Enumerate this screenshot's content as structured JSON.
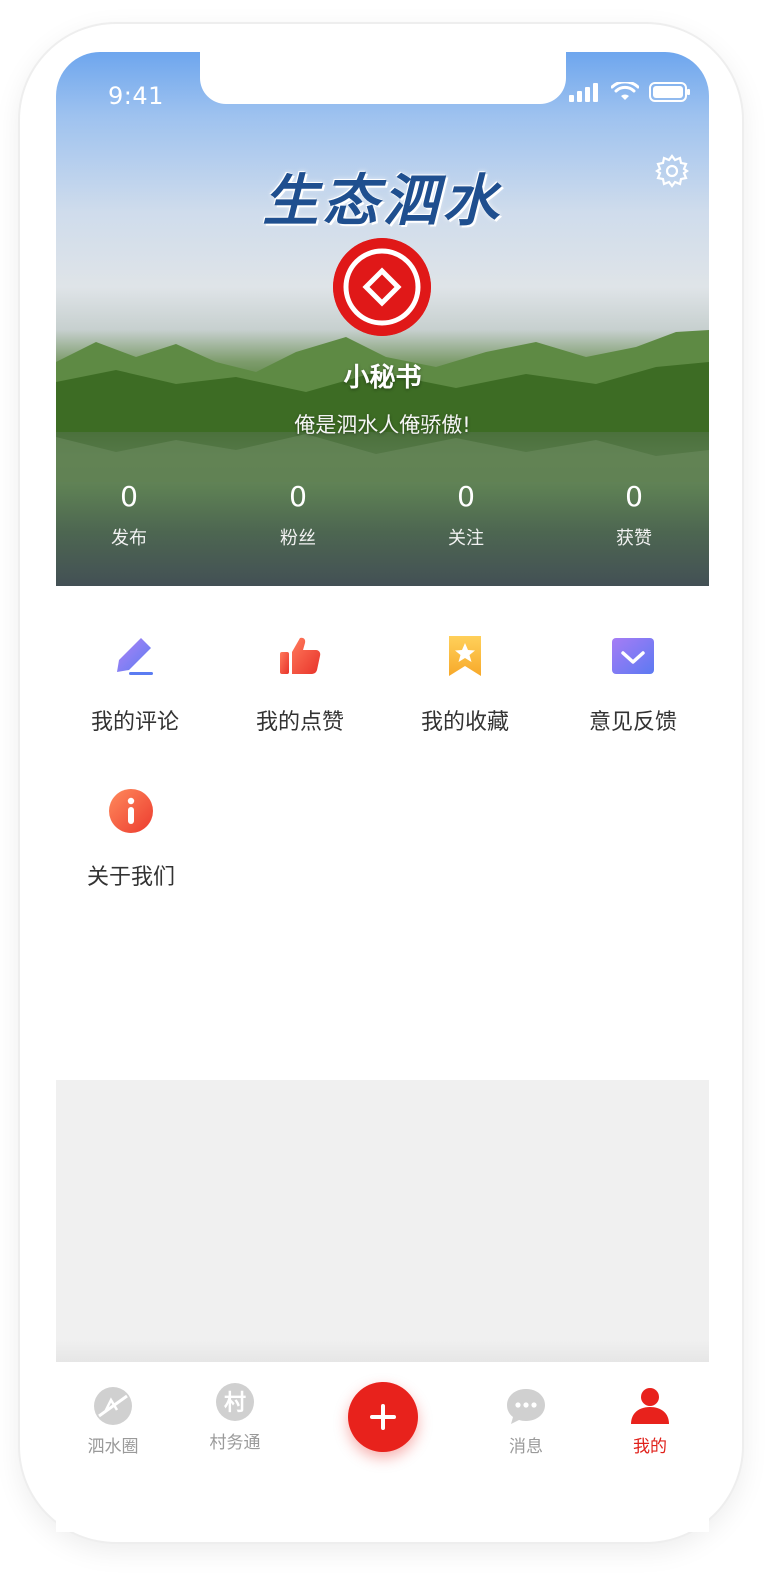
{
  "status_bar": {
    "time": "9:41"
  },
  "header": {
    "logo_text": "生态泗水",
    "username": "小秘书",
    "bio": "俺是泗水人俺骄傲!",
    "stats": [
      {
        "value": "0",
        "label": "发布"
      },
      {
        "value": "0",
        "label": "粉丝"
      },
      {
        "value": "0",
        "label": "关注"
      },
      {
        "value": "0",
        "label": "获赞"
      }
    ]
  },
  "menu": {
    "items": [
      {
        "label": "我的评论",
        "icon": "pencil-icon"
      },
      {
        "label": "我的点赞",
        "icon": "thumbs-up-icon"
      },
      {
        "label": "我的收藏",
        "icon": "bookmark-star-icon"
      },
      {
        "label": "意见反馈",
        "icon": "feedback-icon"
      },
      {
        "label": "关于我们",
        "icon": "info-icon"
      }
    ]
  },
  "tabbar": {
    "items": [
      {
        "label": "泗水圈",
        "icon": "circle-icon",
        "active": false
      },
      {
        "label": "村务通",
        "icon": "village-icon",
        "icon_text": "村",
        "active": false
      },
      {
        "label": "",
        "icon": "plus-icon",
        "active": false
      },
      {
        "label": "消息",
        "icon": "chat-bubble-icon",
        "active": false
      },
      {
        "label": "我的",
        "icon": "user-icon",
        "active": true
      }
    ]
  },
  "colors": {
    "accent": "#e8221c",
    "text": "#333333",
    "muted": "#9a9a9a",
    "gray_bg": "#f0f0f0"
  }
}
